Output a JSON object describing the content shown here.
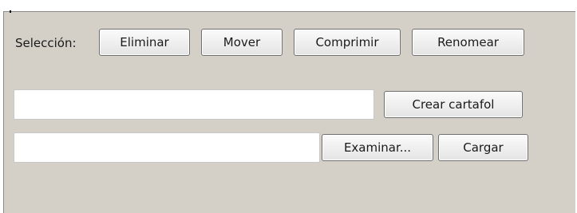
{
  "selection": {
    "label": "Selección:",
    "buttons": {
      "delete": "Eliminar",
      "move": "Mover",
      "compress": "Comprimir",
      "rename": "Renomear"
    }
  },
  "create_folder": {
    "input_value": "",
    "button_label": "Crear cartafol"
  },
  "upload": {
    "input_value": "",
    "browse_label": "Examinar...",
    "load_label": "Cargar"
  }
}
